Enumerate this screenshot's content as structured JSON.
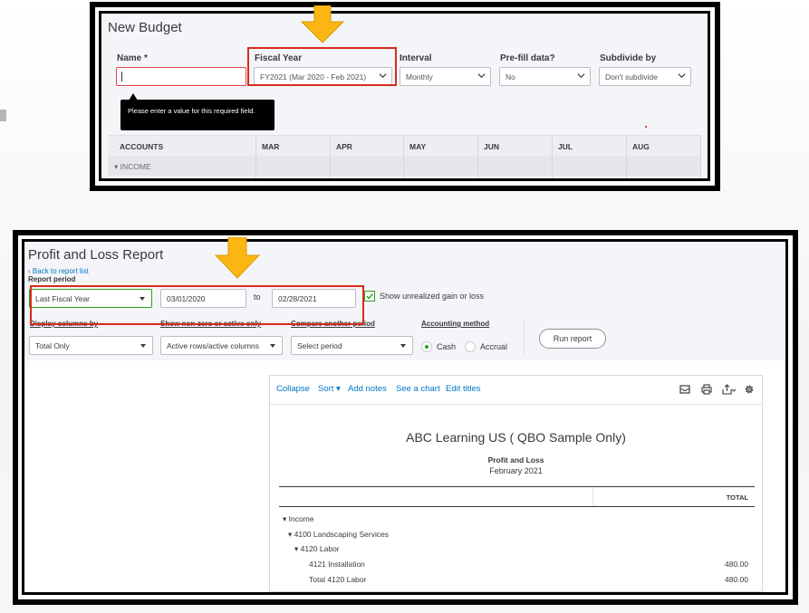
{
  "budget": {
    "title": "New Budget",
    "fields": {
      "name": {
        "label": "Name *",
        "value": ""
      },
      "fiscal_year": {
        "label": "Fiscal Year",
        "value": "FY2021 (Mar 2020 - Feb 2021)"
      },
      "interval": {
        "label": "Interval",
        "value": "Monthly"
      },
      "prefill": {
        "label": "Pre-fill data?",
        "value": "No"
      },
      "subdivide": {
        "label": "Subdivide by",
        "value": "Don't subdivide"
      }
    },
    "tooltip": "Please enter a value for this required field.",
    "grid": {
      "headers": [
        "ACCOUNTS",
        "MAR",
        "APR",
        "MAY",
        "JUN",
        "JUL",
        "AUG"
      ],
      "row_income": "▾ INCOME"
    }
  },
  "report": {
    "title": "Profit and Loss Report",
    "back_link": "Back to report list",
    "period_label": "Report period",
    "period_value": "Last Fiscal Year",
    "from_date": "03/01/2020",
    "to_label": "to",
    "to_date": "02/28/2021",
    "show_unrealized": "Show unrealized gain or loss",
    "display_columns": {
      "label": "Display columns by",
      "value": "Total Only"
    },
    "show_nonzero": {
      "label": "Show non-zero or active only",
      "value": "Active rows/active columns"
    },
    "compare": {
      "label": "Compare another period",
      "value": "Select period"
    },
    "accounting": {
      "label": "Accounting method",
      "cash": "Cash",
      "accrual": "Accrual"
    },
    "run_button": "Run report",
    "toolbar": {
      "collapse": "Collapse",
      "sort": "Sort ▾",
      "add_notes": "Add notes",
      "see_chart": "See a chart",
      "edit_titles": "Edit titles"
    },
    "company": "ABC Learning US ( QBO Sample Only)",
    "report_name": "Profit and Loss",
    "report_date": "February 2021",
    "total_header": "TOTAL",
    "rows": [
      {
        "label": "▾ Income",
        "value": ""
      },
      {
        "label": "▾ 4100 Landscaping Services",
        "value": ""
      },
      {
        "label": "▾ 4120 Labor",
        "value": ""
      },
      {
        "label": "4121 Installation",
        "value": "480.00"
      },
      {
        "label": "Total 4120 Labor",
        "value": "480.00"
      }
    ]
  },
  "colors": {
    "highlight_red": "#d52b1e",
    "arrow_yellow": "#fbb614",
    "link_blue": "#0077c5",
    "qb_green": "#2ca01c"
  }
}
